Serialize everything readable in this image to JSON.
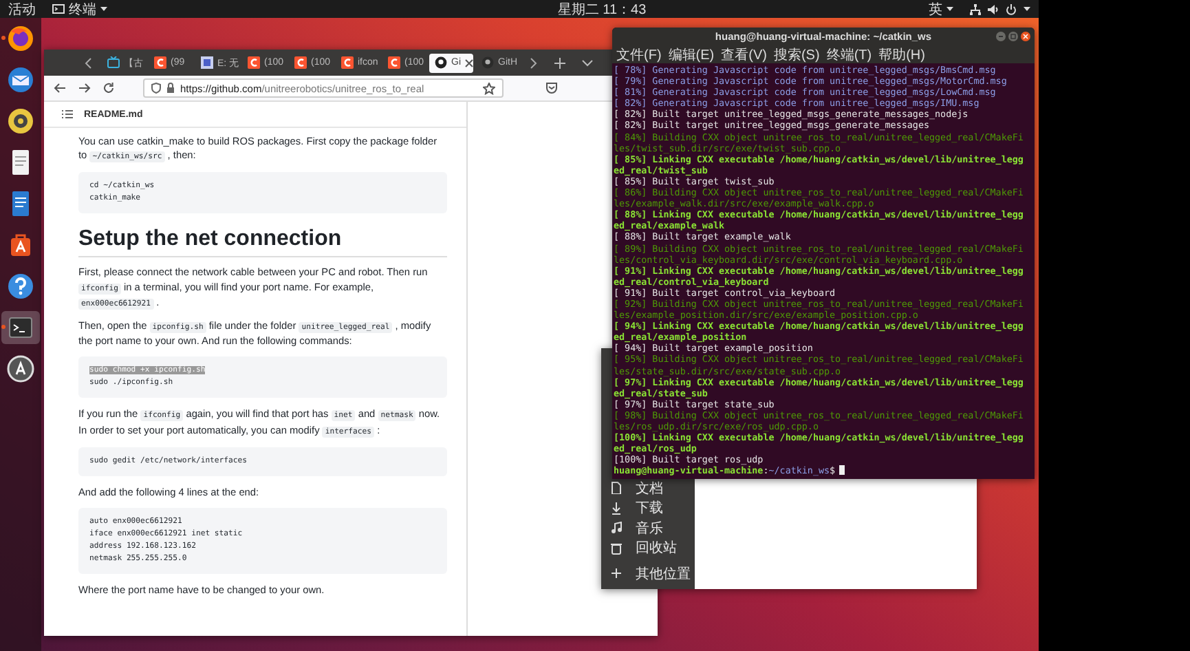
{
  "top_bar": {
    "activities": "活动",
    "app_menu": "终端",
    "clock": "星期二 11：43",
    "input_method": "英"
  },
  "dock": {
    "items": [
      {
        "kind": "browser",
        "running": true,
        "selected": false
      },
      {
        "kind": "mail",
        "running": false,
        "selected": false
      },
      {
        "kind": "speaker",
        "running": false,
        "selected": false
      },
      {
        "kind": "document",
        "running": false,
        "selected": false
      },
      {
        "kind": "writer",
        "running": false,
        "selected": false
      },
      {
        "kind": "store",
        "running": false,
        "selected": false
      },
      {
        "kind": "help",
        "running": false,
        "selected": false
      },
      {
        "kind": "terminal",
        "running": true,
        "selected": true
      },
      {
        "kind": "updater",
        "running": false,
        "selected": false
      }
    ]
  },
  "browser": {
    "tabs": [
      {
        "label": "【古",
        "kind": "tv",
        "selected": false
      },
      {
        "label": "(99",
        "kind": "c",
        "selected": false
      },
      {
        "label": "E: 无",
        "kind": "puzzle",
        "selected": false
      },
      {
        "label": "(100",
        "kind": "c",
        "selected": false
      },
      {
        "label": "(100",
        "kind": "c",
        "selected": false
      },
      {
        "label": "ifcon",
        "kind": "c",
        "selected": false
      },
      {
        "label": "(100",
        "kind": "c",
        "selected": false
      },
      {
        "label": "Gi",
        "kind": "github",
        "selected": true
      },
      {
        "label": "GitH",
        "kind": "github",
        "selected": false
      }
    ],
    "url": {
      "host": "https://github.com",
      "path": "/unitreerobotics/unitree_ros_to_real"
    },
    "readme": {
      "file": "README.md",
      "blocks": [
        {
          "kind": "p",
          "parts": [
            {
              "text": "You can use catkin_make to build ROS packages. First copy the package folder to ",
              "kind": "text"
            },
            {
              "text": "~/catkin_ws/src",
              "kind": "code"
            },
            {
              "text": " , then:",
              "kind": "text"
            }
          ]
        },
        {
          "kind": "code",
          "lines": [
            {
              "text": "cd ~/catkin_ws",
              "selected": false
            },
            {
              "text": "catkin_make",
              "selected": false
            }
          ]
        },
        {
          "kind": "h2",
          "text": "Setup the net connection"
        },
        {
          "kind": "p",
          "parts": [
            {
              "text": "First, please connect the network cable between your PC and robot. Then run ",
              "kind": "text"
            },
            {
              "text": "ifconfig",
              "kind": "code"
            },
            {
              "text": " in a terminal, you will find your port name. For example, ",
              "kind": "text"
            },
            {
              "text": "enx000ec6612921",
              "kind": "code"
            },
            {
              "text": " .",
              "kind": "text"
            }
          ]
        },
        {
          "kind": "p",
          "parts": [
            {
              "text": "Then, open the ",
              "kind": "text"
            },
            {
              "text": "ipconfig.sh",
              "kind": "code"
            },
            {
              "text": " file under the folder ",
              "kind": "text"
            },
            {
              "text": "unitree_legged_real",
              "kind": "code"
            },
            {
              "text": " , modify the port name to your own. And run the following commands:",
              "kind": "text"
            }
          ]
        },
        {
          "kind": "code",
          "lines": [
            {
              "text": "sudo chmod +x ipconfig.sh",
              "selected": true
            },
            {
              "text": "sudo ./ipconfig.sh",
              "selected": false
            }
          ]
        },
        {
          "kind": "p",
          "parts": [
            {
              "text": "If you run the ",
              "kind": "text"
            },
            {
              "text": "ifconfig",
              "kind": "code"
            },
            {
              "text": " again, you will find that port has ",
              "kind": "text"
            },
            {
              "text": "inet",
              "kind": "code"
            },
            {
              "text": " and ",
              "kind": "text"
            },
            {
              "text": "netmask",
              "kind": "code"
            },
            {
              "text": " now. In order to set your port automatically, you can modify ",
              "kind": "text"
            },
            {
              "text": "interfaces",
              "kind": "code"
            },
            {
              "text": " :",
              "kind": "text"
            }
          ]
        },
        {
          "kind": "code",
          "lines": [
            {
              "text": "sudo gedit /etc/network/interfaces",
              "selected": false
            }
          ]
        },
        {
          "kind": "p",
          "parts": [
            {
              "text": "And add the following 4 lines at the end:",
              "kind": "text"
            }
          ]
        },
        {
          "kind": "code",
          "lines": [
            {
              "text": "auto enx000ec6612921",
              "selected": false
            },
            {
              "text": "iface enx000ec6612921 inet static",
              "selected": false
            },
            {
              "text": "address 192.168.123.162",
              "selected": false
            },
            {
              "text": "netmask 255.255.255.0",
              "selected": false
            }
          ]
        },
        {
          "kind": "p",
          "parts": [
            {
              "text": "Where the port name have to be changed to your own.",
              "kind": "text"
            }
          ]
        }
      ]
    }
  },
  "file_manager": {
    "places": [
      {
        "label": "文档",
        "kind": "document"
      },
      {
        "label": "下载",
        "kind": "download"
      },
      {
        "label": "音乐",
        "kind": "music"
      },
      {
        "label": "回收站",
        "kind": "trash"
      },
      {
        "label": "其他位置",
        "kind": "plus"
      }
    ]
  },
  "terminal": {
    "title": "huang@huang-virtual-machine: ~/catkin_ws",
    "menu": [
      "文件(F)",
      "编辑(E)",
      "查看(V)",
      "搜索(S)",
      "终端(T)",
      "帮助(H)"
    ],
    "lines": [
      {
        "kind": "blue",
        "text": "[ 78%] Generating Javascript code from unitree_legged_msgs/BmsCmd.msg"
      },
      {
        "kind": "blue",
        "text": "[ 79%] Generating Javascript code from unitree_legged_msgs/MotorCmd.msg"
      },
      {
        "kind": "blue",
        "text": "[ 81%] Generating Javascript code from unitree_legged_msgs/LowCmd.msg"
      },
      {
        "kind": "blue",
        "text": "[ 82%] Generating Javascript code from unitree_legged_msgs/IMU.msg"
      },
      {
        "kind": "plain",
        "text": "[ 82%] Built target unitree_legged_msgs_generate_messages_nodejs"
      },
      {
        "kind": "plain",
        "text": "[ 82%] Built target unitree_legged_msgs_generate_messages"
      },
      {
        "kind": "dim",
        "text": "[ 84%] Building CXX object unitree_ros_to_real/unitree_legged_real/CMakeFi"
      },
      {
        "kind": "dim",
        "text": "les/twist_sub.dir/src/exe/twist_sub.cpp.o"
      },
      {
        "kind": "bold",
        "text": "[ 85%] Linking CXX executable /home/huang/catkin_ws/devel/lib/unitree_legg"
      },
      {
        "kind": "bold",
        "text": "ed_real/twist_sub"
      },
      {
        "kind": "plain",
        "text": "[ 85%] Built target twist_sub"
      },
      {
        "kind": "dim",
        "text": "[ 86%] Building CXX object unitree_ros_to_real/unitree_legged_real/CMakeFi"
      },
      {
        "kind": "dim",
        "text": "les/example_walk.dir/src/exe/example_walk.cpp.o"
      },
      {
        "kind": "bold",
        "text": "[ 88%] Linking CXX executable /home/huang/catkin_ws/devel/lib/unitree_legg"
      },
      {
        "kind": "bold",
        "text": "ed_real/example_walk"
      },
      {
        "kind": "plain",
        "text": "[ 88%] Built target example_walk"
      },
      {
        "kind": "dim",
        "text": "[ 89%] Building CXX object unitree_ros_to_real/unitree_legged_real/CMakeFi"
      },
      {
        "kind": "dim",
        "text": "les/control_via_keyboard.dir/src/exe/control_via_keyboard.cpp.o"
      },
      {
        "kind": "bold",
        "text": "[ 91%] Linking CXX executable /home/huang/catkin_ws/devel/lib/unitree_legg"
      },
      {
        "kind": "bold",
        "text": "ed_real/control_via_keyboard"
      },
      {
        "kind": "plain",
        "text": "[ 91%] Built target control_via_keyboard"
      },
      {
        "kind": "dim",
        "text": "[ 92%] Building CXX object unitree_ros_to_real/unitree_legged_real/CMakeFi"
      },
      {
        "kind": "dim",
        "text": "les/example_position.dir/src/exe/example_position.cpp.o"
      },
      {
        "kind": "bold",
        "text": "[ 94%] Linking CXX executable /home/huang/catkin_ws/devel/lib/unitree_legg"
      },
      {
        "kind": "bold",
        "text": "ed_real/example_position"
      },
      {
        "kind": "plain",
        "text": "[ 94%] Built target example_position"
      },
      {
        "kind": "dim",
        "text": "[ 95%] Building CXX object unitree_ros_to_real/unitree_legged_real/CMakeFi"
      },
      {
        "kind": "dim",
        "text": "les/state_sub.dir/src/exe/state_sub.cpp.o"
      },
      {
        "kind": "bold",
        "text": "[ 97%] Linking CXX executable /home/huang/catkin_ws/devel/lib/unitree_legg"
      },
      {
        "kind": "bold",
        "text": "ed_real/state_sub"
      },
      {
        "kind": "plain",
        "text": "[ 97%] Built target state_sub"
      },
      {
        "kind": "dim",
        "text": "[ 98%] Building CXX object unitree_ros_to_real/unitree_legged_real/CMakeFi"
      },
      {
        "kind": "dim",
        "text": "les/ros_udp.dir/src/exe/ros_udp.cpp.o"
      },
      {
        "kind": "bold",
        "text": "[100%] Linking CXX executable /home/huang/catkin_ws/devel/lib/unitree_legg"
      },
      {
        "kind": "bold",
        "text": "ed_real/ros_udp"
      },
      {
        "kind": "plain",
        "text": "[100%] Built target ros_udp"
      },
      {
        "kind": "prompt",
        "parts": [
          {
            "kind": "bold",
            "text": "huang@huang-virtual-machine"
          },
          {
            "kind": "plain",
            "text": ":"
          },
          {
            "kind": "blue",
            "text": "~/catkin_ws"
          },
          {
            "kind": "plain",
            "text": "$"
          }
        ]
      }
    ]
  }
}
